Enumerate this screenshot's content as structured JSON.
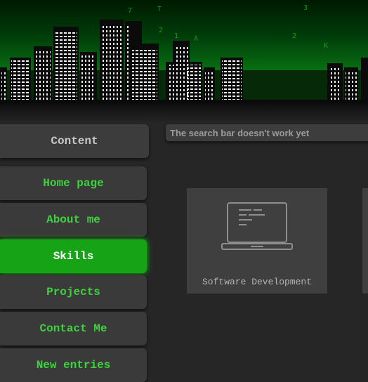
{
  "search": {
    "placeholder": "The search bar doesn't work yet"
  },
  "sidebar": {
    "header": "Content",
    "items": [
      {
        "label": "Home page",
        "active": false
      },
      {
        "label": "About me",
        "active": false
      },
      {
        "label": "Skills",
        "active": true
      },
      {
        "label": "Projects",
        "active": false
      },
      {
        "label": "Contact Me",
        "active": false
      },
      {
        "label": "New entries",
        "active": false
      }
    ]
  },
  "cards": [
    {
      "label": "Software Development",
      "icon": "laptop-code-icon"
    }
  ],
  "banner": {
    "matrix_chars": [
      "7",
      "T",
      "3",
      "2",
      "1",
      "A",
      "2",
      "K"
    ]
  },
  "colors": {
    "accent": "#16a316",
    "nav_text": "#3dd33d",
    "background": "#262626",
    "panel": "#3a3a3a"
  }
}
